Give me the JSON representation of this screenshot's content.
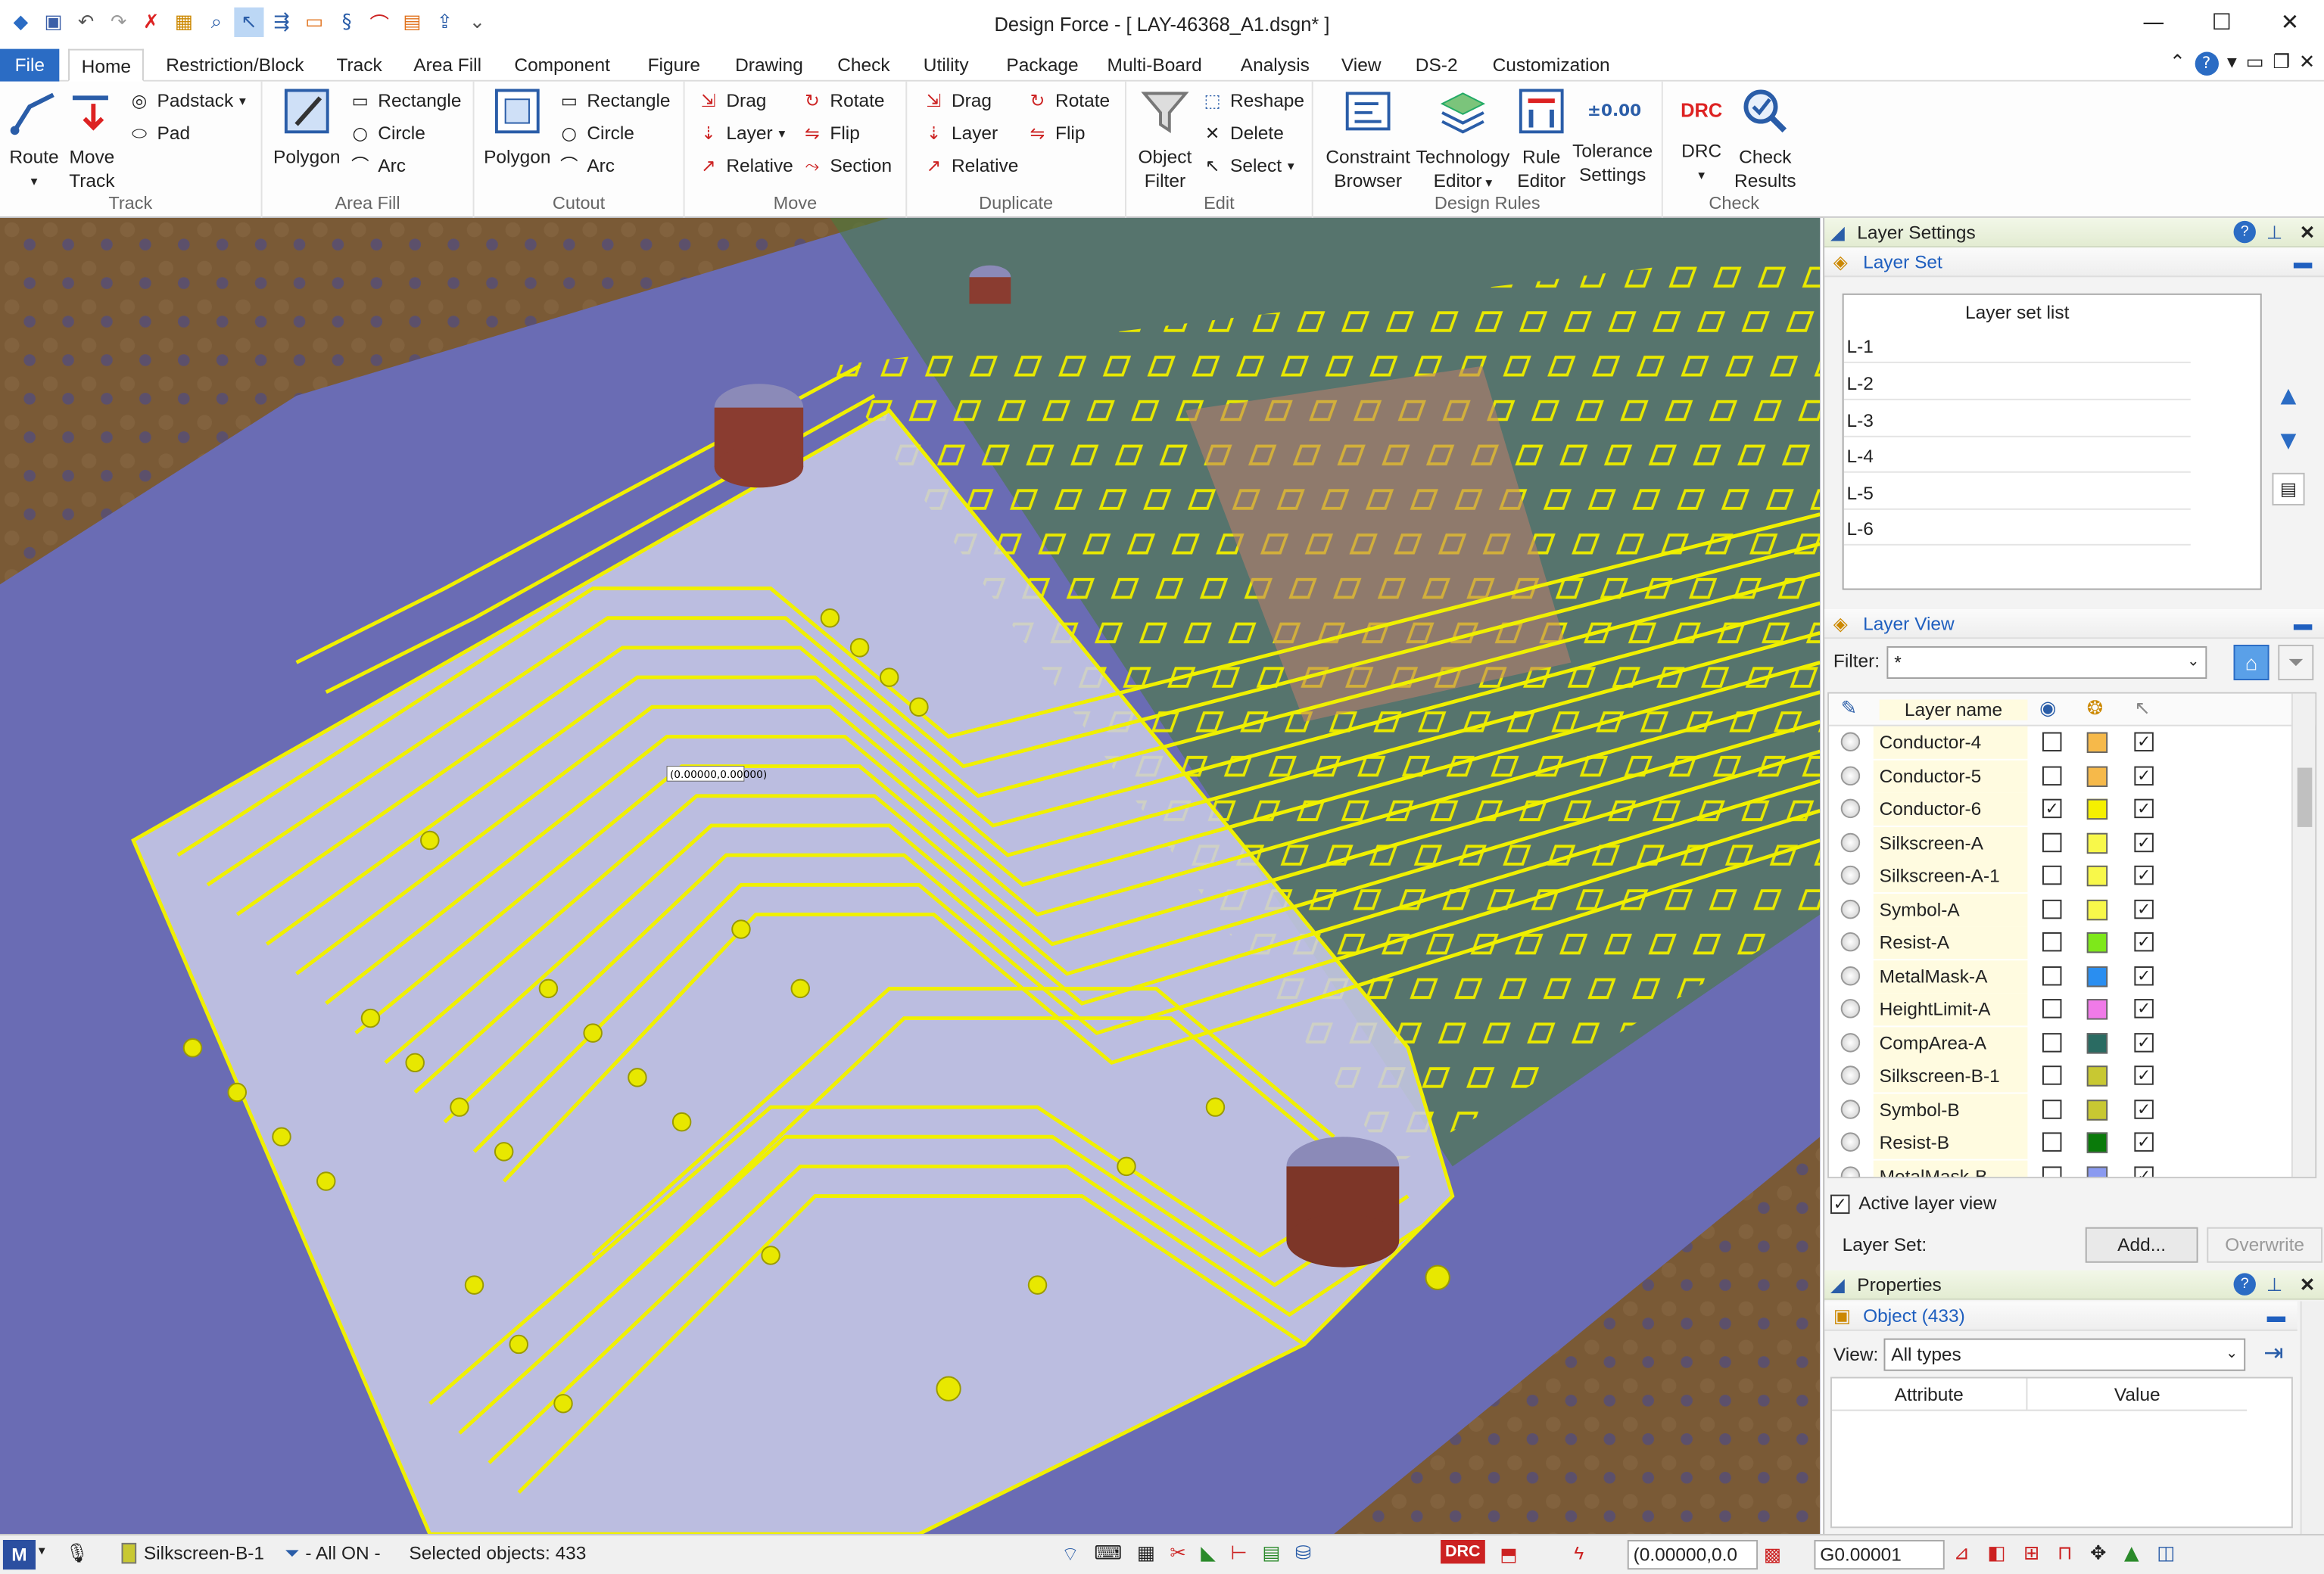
{
  "window": {
    "title": "Design Force - [ LAY-46368_A1.dsgn* ]"
  },
  "qat_icons": [
    "app-icon",
    "save-icon",
    "undo-icon",
    "redo-icon",
    "cancel-icon",
    "grid-icon",
    "zoom-icon",
    "select-mode-icon",
    "route-icon",
    "comment-icon",
    "snap-icon",
    "graph-icon",
    "pdf-icon",
    "export-icon",
    "customize-icon"
  ],
  "menu": {
    "tabs": [
      "File",
      "Home",
      "Restriction/Block",
      "Track",
      "Area Fill",
      "Component",
      "Figure",
      "Drawing",
      "Check",
      "Utility",
      "Package",
      "Multi-Board",
      "Analysis",
      "View",
      "DS-2",
      "Customization"
    ],
    "active": "Home"
  },
  "ribbon": {
    "track": {
      "label": "Track",
      "route": "Route",
      "move_track_1": "Move",
      "move_track_2": "Track",
      "padstack": "Padstack",
      "pad": "Pad"
    },
    "area_fill": {
      "label": "Area Fill",
      "polygon": "Polygon",
      "rectangle": "Rectangle",
      "circle": "Circle",
      "arc": "Arc"
    },
    "cutout": {
      "label": "Cutout",
      "polygon": "Polygon",
      "rectangle": "Rectangle",
      "circle": "Circle",
      "arc": "Arc"
    },
    "move": {
      "label": "Move",
      "drag": "Drag",
      "layer": "Layer",
      "relative": "Relative",
      "rotate": "Rotate",
      "flip": "Flip",
      "section": "Section"
    },
    "duplicate": {
      "label": "Duplicate",
      "drag": "Drag",
      "layer": "Layer",
      "relative": "Relative",
      "rotate": "Rotate",
      "flip": "Flip"
    },
    "edit": {
      "label": "Edit",
      "object_filter_1": "Object",
      "object_filter_2": "Filter",
      "reshape": "Reshape",
      "delete": "Delete",
      "select": "Select"
    },
    "design_rules": {
      "label": "Design Rules",
      "constraint_1": "Constraint",
      "constraint_2": "Browser",
      "tech_1": "Technology",
      "tech_2": "Editor",
      "rule_1": "Rule",
      "rule_2": "Editor",
      "tol_1": "Tolerance",
      "tol_2": "Settings",
      "tol_icon_text": "±0.00"
    },
    "check": {
      "label": "Check",
      "drc": "DRC",
      "drc_icon_text": "DRC",
      "results_1": "Check",
      "results_2": "Results"
    }
  },
  "canvas": {
    "coord_tooltip": "(0.00000,0.00000)"
  },
  "layer_settings": {
    "title": "Layer Settings",
    "layer_set": {
      "title": "Layer Set",
      "list_header": "Layer set list",
      "items": [
        "L-1",
        "L-2",
        "L-3",
        "L-4",
        "L-5",
        "L-6"
      ]
    },
    "layer_view": {
      "title": "Layer View",
      "filter_label": "Filter:",
      "filter_value": "*",
      "col_name": "Layer name",
      "layers": [
        {
          "name": "Conductor-4",
          "visible": false,
          "color": "#f6b94a",
          "select": true
        },
        {
          "name": "Conductor-5",
          "visible": false,
          "color": "#f6b94a",
          "select": true
        },
        {
          "name": "Conductor-6",
          "visible": true,
          "color": "#f5f000",
          "select": true
        },
        {
          "name": "Silkscreen-A",
          "visible": false,
          "color": "#f8f84a",
          "select": true
        },
        {
          "name": "Silkscreen-A-1",
          "visible": false,
          "color": "#f8f84a",
          "select": true
        },
        {
          "name": "Symbol-A",
          "visible": false,
          "color": "#f8f84a",
          "select": true
        },
        {
          "name": "Resist-A",
          "visible": false,
          "color": "#7ee81a",
          "select": true
        },
        {
          "name": "MetalMask-A",
          "visible": false,
          "color": "#2a8ef0",
          "select": true
        },
        {
          "name": "HeightLimit-A",
          "visible": false,
          "color": "#f07ae8",
          "select": true
        },
        {
          "name": "CompArea-A",
          "visible": false,
          "color": "#2a6b62",
          "select": true
        },
        {
          "name": "Silkscreen-B-1",
          "visible": false,
          "color": "#c8c832",
          "select": true
        },
        {
          "name": "Symbol-B",
          "visible": false,
          "color": "#c8c832",
          "select": true
        },
        {
          "name": "Resist-B",
          "visible": false,
          "color": "#0a7a0a",
          "select": true
        },
        {
          "name": "MetalMask-B",
          "visible": false,
          "color": "#8a9af0",
          "select": true
        }
      ],
      "active_layer_view": "Active layer view",
      "layer_set_label": "Layer Set:",
      "add_button": "Add...",
      "overwrite_button": "Overwrite"
    }
  },
  "properties": {
    "title": "Properties",
    "object": "Object (433)",
    "view_label": "View:",
    "view_value": "All types",
    "col_attribute": "Attribute",
    "col_value": "Value"
  },
  "status": {
    "layer": "Silkscreen-B-1",
    "filter": "- All ON -",
    "selected": "Selected objects: 433",
    "coords": "(0.00000,0.0",
    "grid": "G0.00001",
    "drc": "DRC"
  }
}
